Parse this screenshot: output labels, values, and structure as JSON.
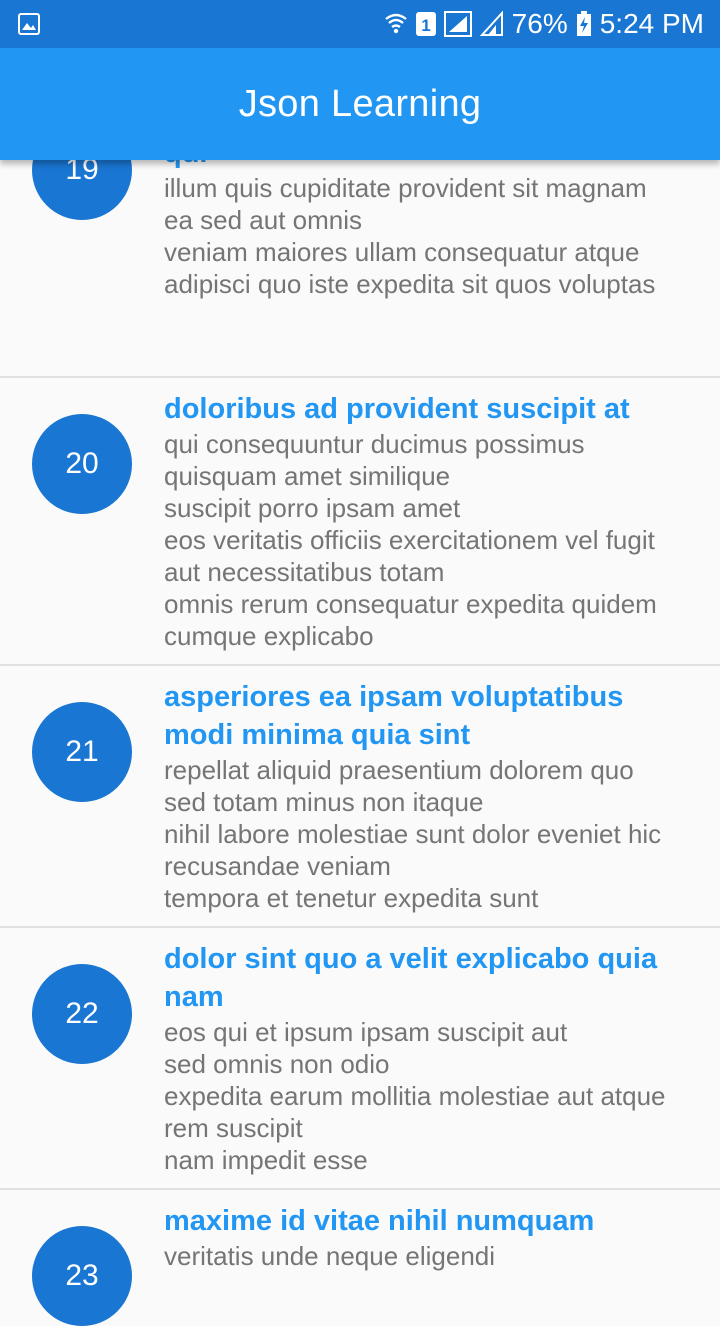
{
  "status_bar": {
    "battery": "76%",
    "time": "5:24 PM",
    "sim_slot": "1"
  },
  "app_bar": {
    "title": "Json Learning"
  },
  "posts": [
    {
      "id": "19",
      "title": "qui",
      "body": "illum quis cupiditate provident sit magnam\nea sed aut omnis\nveniam maiores ullam consequatur atque\nadipisci quo iste expedita sit quos voluptas"
    },
    {
      "id": "20",
      "title": "doloribus ad provident suscipit at",
      "body": "qui consequuntur ducimus possimus quisquam amet similique\nsuscipit porro ipsam amet\neos veritatis officiis exercitationem vel fugit aut necessitatibus totam\nomnis rerum consequatur expedita quidem cumque explicabo"
    },
    {
      "id": "21",
      "title": "asperiores ea ipsam voluptatibus modi minima quia sint",
      "body": "repellat aliquid praesentium dolorem quo\nsed totam minus non itaque\nnihil labore molestiae sunt dolor eveniet hic recusandae veniam\ntempora et tenetur expedita sunt"
    },
    {
      "id": "22",
      "title": "dolor sint quo a velit explicabo quia nam",
      "body": "eos qui et ipsum ipsam suscipit aut\nsed omnis non odio\nexpedita earum mollitia molestiae aut atque rem suscipit\nnam impedit esse"
    },
    {
      "id": "23",
      "title": "maxime id vitae nihil numquam",
      "body": "veritatis unde neque eligendi"
    }
  ],
  "colors": {
    "status_bar": "#1976d2",
    "app_bar": "#2196f3",
    "avatar": "#1976d2",
    "title_text": "#2196f3",
    "body_text": "#757575"
  }
}
